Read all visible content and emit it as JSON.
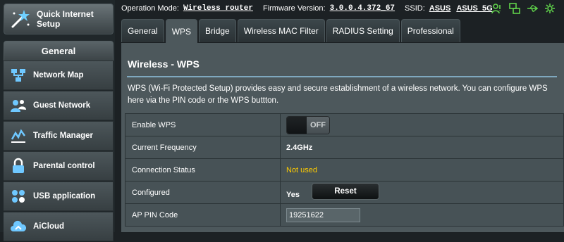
{
  "sidebar": {
    "quick_setup_label": "Quick Internet Setup",
    "section_title": "General",
    "items": [
      {
        "label": "Network Map",
        "icon": "network-map-icon"
      },
      {
        "label": "Guest Network",
        "icon": "guest-network-icon"
      },
      {
        "label": "Traffic Manager",
        "icon": "traffic-manager-icon"
      },
      {
        "label": "Parental control",
        "icon": "parental-control-icon"
      },
      {
        "label": "USB application",
        "icon": "usb-application-icon"
      },
      {
        "label": "AiCloud",
        "icon": "aicloud-icon"
      }
    ]
  },
  "status_bar": {
    "operation_mode_label": "Operation Mode:",
    "operation_mode_value": "Wireless router",
    "firmware_label": "Firmware Version:",
    "firmware_value": "3.0.0.4.372_67",
    "ssid_label": "SSID:",
    "ssid_values": [
      "ASUS",
      "ASUS_5G"
    ],
    "icons": [
      "clients-icon",
      "network-status-icon",
      "usb-status-icon",
      "settings-icon"
    ],
    "icon_color": "#5fd14a"
  },
  "tabs": [
    {
      "label": "General",
      "active": false
    },
    {
      "label": "WPS",
      "active": true
    },
    {
      "label": "Bridge",
      "active": false
    },
    {
      "label": "Wireless MAC Filter",
      "active": false
    },
    {
      "label": "RADIUS Setting",
      "active": false
    },
    {
      "label": "Professional",
      "active": false
    }
  ],
  "panel": {
    "title": "Wireless - WPS",
    "description": "WPS (Wi-Fi Protected Setup) provides easy and secure establishment of a wireless network. You can configure WPS here via the PIN code or the WPS buttton."
  },
  "form": {
    "enable_wps_label": "Enable WPS",
    "enable_wps_state": "OFF",
    "frequency_label": "Current Frequency",
    "frequency_value": "2.4GHz",
    "connection_status_label": "Connection Status",
    "connection_status_value": "Not used",
    "configured_label": "Configured",
    "configured_value": "Yes",
    "reset_button_label": "Reset",
    "ap_pin_label": "AP PIN Code",
    "ap_pin_value": "19251622"
  },
  "colors": {
    "accent_rule": "#7fa8bf",
    "status_warning": "#ffcc00",
    "panel_bg": "#4d585c"
  }
}
